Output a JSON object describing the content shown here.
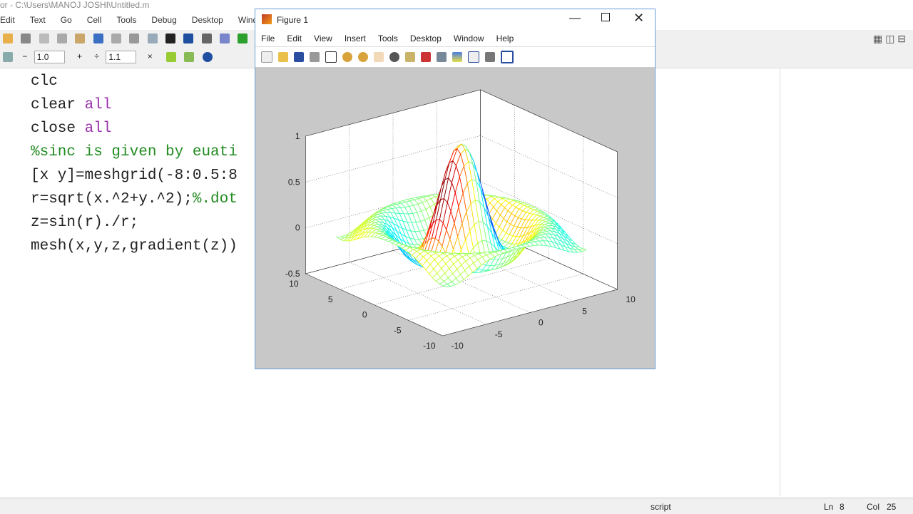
{
  "editor": {
    "title": "or - C:\\Users\\MANOJ JOSHI\\Untitled.m",
    "menu": [
      "Edit",
      "Text",
      "Go",
      "Cell",
      "Tools",
      "Debug",
      "Desktop",
      "Window"
    ],
    "cell_minus": "−",
    "cell_value1": "1.0",
    "cell_plus": "+",
    "cell_div": "÷",
    "cell_value2": "1.1",
    "cell_times": "×",
    "code": [
      {
        "text": "clc"
      },
      {
        "text": "clear ",
        "kw": "all"
      },
      {
        "text": "close ",
        "kw": "all"
      },
      {
        "comment": "%sinc is given by euati"
      },
      {
        "text": "[x y]=meshgrid(-8:0.5:8"
      },
      {
        "text": "r=sqrt(x.^2+y.^2);",
        "comment": "%.dot"
      },
      {
        "text": "z=sin(r)./r;"
      },
      {
        "text": "mesh(x,y,z,gradient(z))"
      }
    ],
    "status": {
      "mode": "script",
      "ln_label": "Ln",
      "ln": "8",
      "col_label": "Col",
      "col": "25"
    }
  },
  "figure": {
    "title": "Figure 1",
    "menu": [
      "File",
      "Edit",
      "View",
      "Insert",
      "Tools",
      "Desktop",
      "Window",
      "Help"
    ],
    "ticks": {
      "z": [
        "1",
        "0.5",
        "0",
        "-0.5"
      ],
      "y": [
        "10",
        "5",
        "0",
        "-5",
        "-10"
      ],
      "x": [
        "-10",
        "-5",
        "0",
        "5",
        "10"
      ]
    },
    "plot": {
      "type": "mesh",
      "function": "z=sin(r)./r",
      "range": [
        -8,
        8
      ],
      "step": 0.5,
      "xlim": [
        -10,
        10
      ],
      "ylim": [
        -10,
        10
      ],
      "zlim": [
        -0.5,
        1
      ],
      "colormap": "jet",
      "grid": true
    }
  }
}
